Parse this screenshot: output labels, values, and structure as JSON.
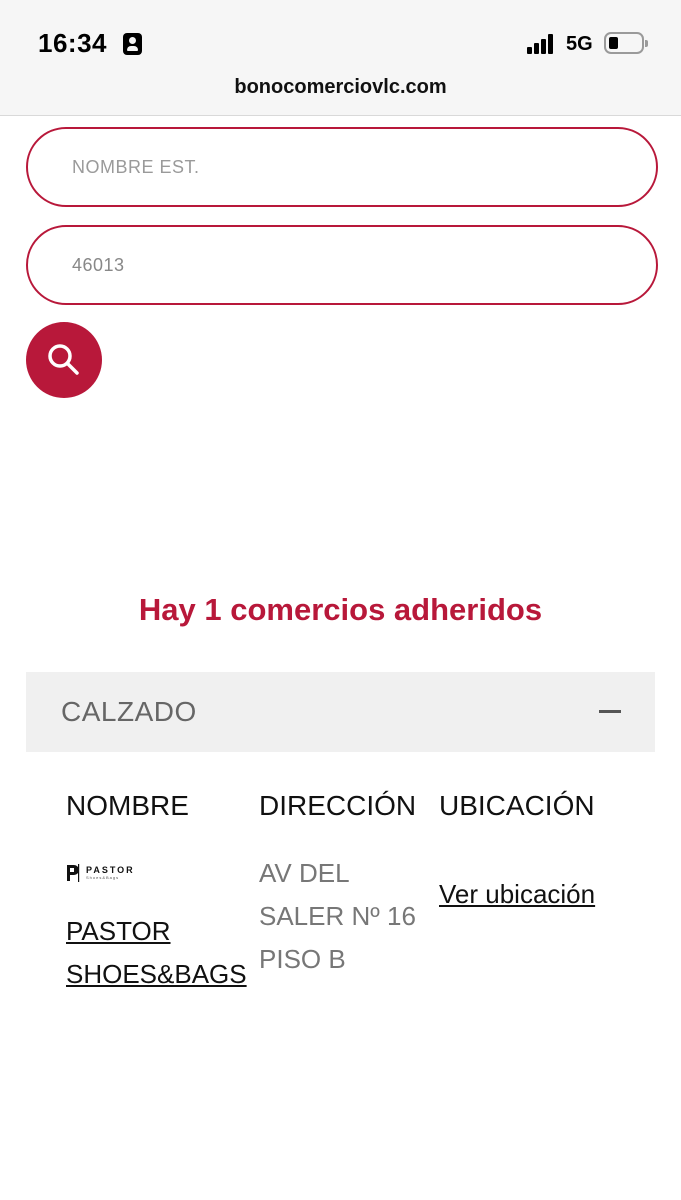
{
  "status_bar": {
    "time": "16:34",
    "network": "5G",
    "url": "bonocomerciovlc.com"
  },
  "search": {
    "name_placeholder": "NOMBRE EST.",
    "zip_value": "46013"
  },
  "results": {
    "count_text": "Hay 1 comercios adheridos"
  },
  "accordion": {
    "title": "CALZADO"
  },
  "table": {
    "headers": [
      "NOMBRE",
      "DIRECCIÓN",
      "UBICACIÓN"
    ],
    "rows": [
      {
        "logo_text": "PASTOR",
        "logo_sub": "Shoes&Bags",
        "name": "PASTOR SHOES&BAGS",
        "address": "AV DEL SALER Nº 16 PISO B",
        "location_link": "Ver ubicación"
      }
    ]
  },
  "colors": {
    "accent": "#b8183a",
    "header_bg": "#f0f0f0"
  }
}
